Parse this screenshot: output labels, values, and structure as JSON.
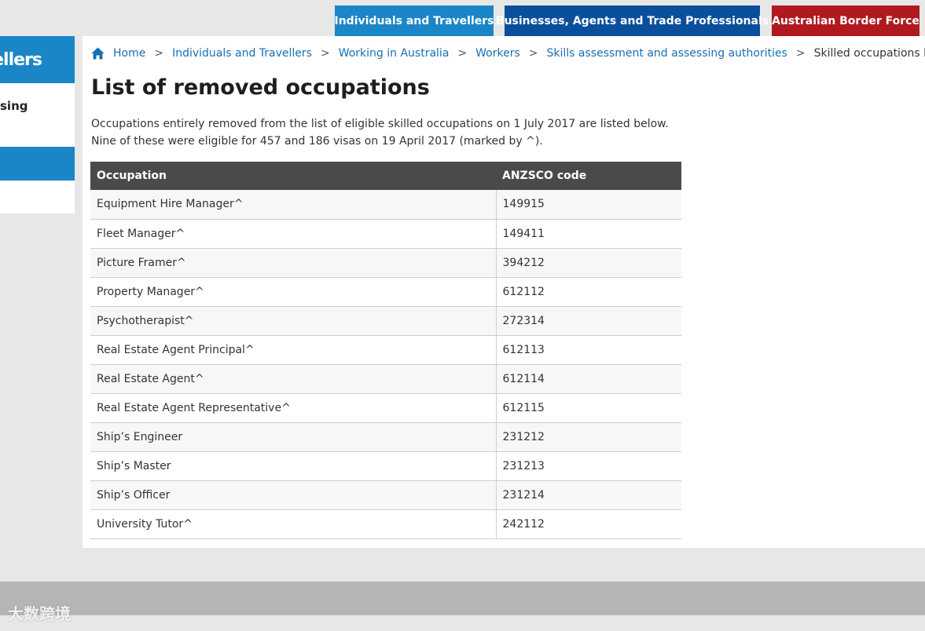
{
  "topnav": {
    "individuals": "Individuals and Travellers",
    "business": "Businesses, Agents and Trade Professionals",
    "abf": "Australian Border Force"
  },
  "sidenav": {
    "title": "vellers",
    "item": "sing"
  },
  "breadcrumb": {
    "home": "Home",
    "items": [
      "Individuals and Travellers",
      "Working in Australia",
      "Workers",
      "Skills assessment and assessing authorities"
    ],
    "current": "Skilled occupations lists",
    "separator": ">"
  },
  "page": {
    "title": "List of removed occupations",
    "intro": "Occupations entirely removed from the list of eligible skilled occupations on 1 July 2017 are listed below. Nine of these were eligible for 457 and 186 visas on 19 April 2017 (marked by ^)."
  },
  "table": {
    "headers": [
      "Occupation",
      "ANZSCO code"
    ],
    "rows": [
      [
        "Equipment Hire Manager^",
        "149915"
      ],
      [
        "Fleet Manager^",
        "149411"
      ],
      [
        "Picture Framer^",
        "394212"
      ],
      [
        "Property Manager^",
        "612112"
      ],
      [
        "Psychotherapist^",
        "272314"
      ],
      [
        "Real Estate Agent Principal^",
        "612113"
      ],
      [
        "Real Estate Agent^",
        "612114"
      ],
      [
        "Real Estate Agent Representative^",
        "612115"
      ],
      [
        "Ship’s Engineer",
        "231212"
      ],
      [
        "Ship’s Master",
        "231213"
      ],
      [
        "Ship’s Officer",
        "231214"
      ],
      [
        "University Tutor^",
        "242112"
      ]
    ]
  },
  "watermark": "大数跨境",
  "colors": {
    "tab_individuals": "#1a86c8",
    "tab_business": "#0a4f9c",
    "tab_abf": "#b01a1e",
    "link": "#1a6fb0",
    "table_header": "#4a4a4a"
  }
}
